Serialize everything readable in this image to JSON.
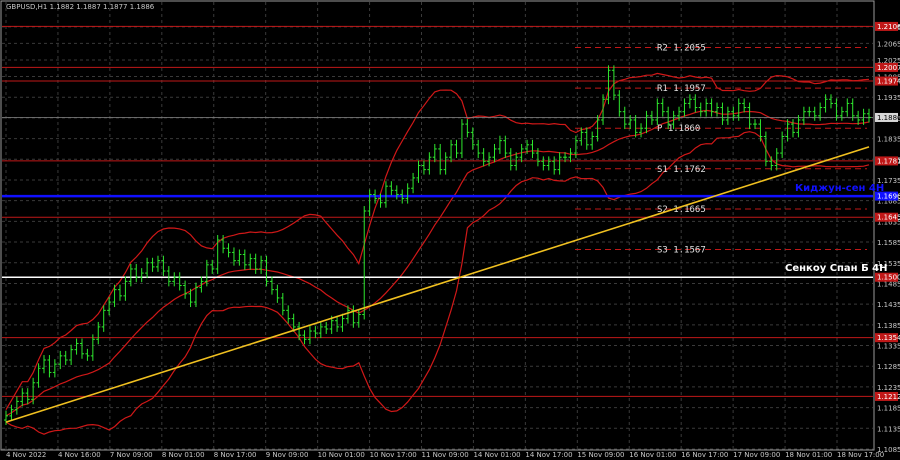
{
  "chart_data": {
    "type": "candlestick",
    "title": "GBPUSD,H1  1.1882 1.1887 1.1877 1.1886",
    "ylim": [
      1.1085,
      1.2165
    ],
    "y_ticks": [
      1.2105,
      1.2065,
      1.2025,
      1.1985,
      1.1935,
      1.1885,
      1.1835,
      1.1785,
      1.1735,
      1.1685,
      1.1635,
      1.1585,
      1.1535,
      1.1485,
      1.1435,
      1.1385,
      1.1335,
      1.1285,
      1.1235,
      1.1185,
      1.1135,
      1.1085
    ],
    "x_labels": [
      "4 Nov 2022",
      "4 Nov 16:00",
      "7 Nov 09:00",
      "8 Nov 01:00",
      "8 Nov 17:00",
      "9 Nov 09:00",
      "10 Nov 01:00",
      "10 Nov 17:00",
      "11 Nov 09:00",
      "14 Nov 01:00",
      "14 Nov 17:00",
      "15 Nov 09:00",
      "16 Nov 01:00",
      "16 Nov 17:00",
      "17 Nov 09:00",
      "18 Nov 01:00",
      "18 Nov 17:00"
    ],
    "current_price": {
      "value": 1.1886,
      "label": "1.1886"
    },
    "levels": [
      {
        "value": 1.2106,
        "label": "1.2106"
      },
      {
        "value": 1.2007,
        "label": "1.2007"
      },
      {
        "value": 1.1974,
        "label": "1.1974"
      },
      {
        "value": 1.1781,
        "label": "1.1781"
      },
      {
        "value": 1.1645,
        "label": "1.1645"
      },
      {
        "value": 1.15,
        "label": "1.1500"
      },
      {
        "value": 1.1354,
        "label": "1.1354"
      },
      {
        "value": 1.1212,
        "label": "1.1212"
      }
    ],
    "pivots": [
      {
        "name": "R2",
        "value": 1.2055,
        "label": "R2 1.2055"
      },
      {
        "name": "R1",
        "value": 1.1957,
        "label": "R1 1.1957"
      },
      {
        "name": "P",
        "value": 1.186,
        "label": "P 1.1860"
      },
      {
        "name": "S1",
        "value": 1.1762,
        "label": "S1 1.1762"
      },
      {
        "name": "S2",
        "value": 1.1665,
        "label": "S2 1.1665"
      },
      {
        "name": "S3",
        "value": 1.1567,
        "label": "S3 1.1567"
      }
    ],
    "kijun": {
      "value": 1.1696,
      "label": "Киджун-сен 4H",
      "box": "1.1696",
      "color": "#1010ff"
    },
    "senkou": {
      "value": 1.15,
      "label": "Сенкоу Спан Б 4H",
      "color": "#ffffff"
    },
    "trendline": {
      "from": [
        0,
        1.115
      ],
      "to": [
        159,
        1.1815
      ],
      "color": "#f0c020"
    },
    "closes": [
      1.1165,
      1.118,
      1.12,
      1.122,
      1.1205,
      1.1245,
      1.128,
      1.13,
      1.127,
      1.129,
      1.131,
      1.13,
      1.1325,
      1.134,
      1.1315,
      1.131,
      1.135,
      1.138,
      1.142,
      1.144,
      1.147,
      1.1455,
      1.149,
      1.152,
      1.15,
      1.151,
      1.1535,
      1.1525,
      1.154,
      1.1515,
      1.149,
      1.15,
      1.148,
      1.146,
      1.144,
      1.1475,
      1.149,
      1.153,
      1.152,
      1.159,
      1.157,
      1.156,
      1.154,
      1.1555,
      1.153,
      1.1545,
      1.152,
      1.154,
      1.149,
      1.147,
      1.145,
      1.142,
      1.14,
      1.138,
      1.136,
      1.135,
      1.137,
      1.1365,
      1.138,
      1.1375,
      1.1395,
      1.138,
      1.14,
      1.142,
      1.139,
      1.141,
      1.166,
      1.17,
      1.169,
      1.168,
      1.172,
      1.171,
      1.17,
      1.169,
      1.1715,
      1.174,
      1.177,
      1.176,
      1.179,
      1.181,
      1.176,
      1.179,
      1.182,
      1.18,
      1.187,
      1.185,
      1.182,
      1.18,
      1.178,
      1.179,
      1.181,
      1.183,
      1.18,
      1.177,
      1.179,
      1.181,
      1.182,
      1.18,
      1.178,
      1.177,
      1.178,
      1.176,
      1.179,
      1.179,
      1.18,
      1.183,
      1.185,
      1.182,
      1.184,
      1.188,
      1.193,
      1.2,
      1.194,
      1.19,
      1.187,
      1.188,
      1.185,
      1.186,
      1.189,
      1.188,
      1.192,
      1.19,
      1.187,
      1.189,
      1.19,
      1.192,
      1.193,
      1.191,
      1.19,
      1.192,
      1.19,
      1.191,
      1.188,
      1.19,
      1.189,
      1.192,
      1.191,
      1.187,
      1.187,
      1.184,
      1.178,
      1.177,
      1.18,
      1.184,
      1.187,
      1.185,
      1.188,
      1.19,
      1.19,
      1.189,
      1.191,
      1.193,
      1.192,
      1.189,
      1.19,
      1.192,
      1.189,
      1.188,
      1.1895,
      1.1886
    ]
  }
}
